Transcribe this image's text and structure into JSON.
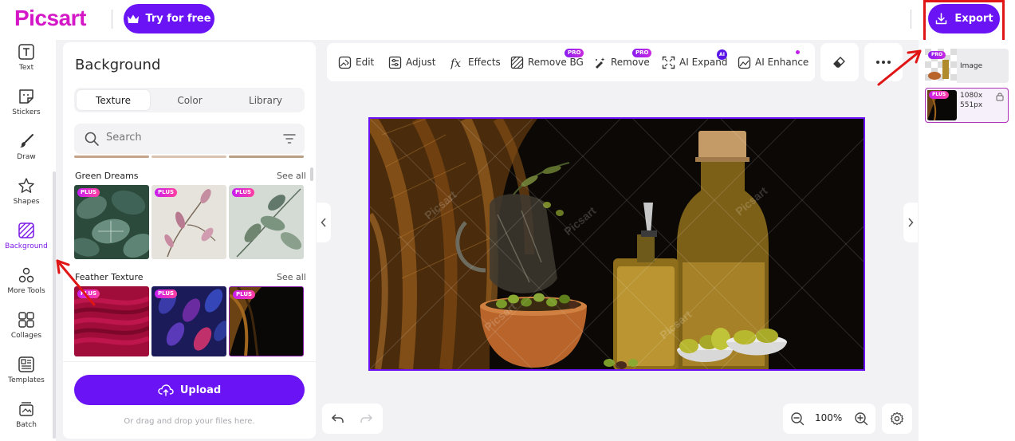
{
  "header": {
    "logo": "Picsart",
    "try_label": "Try for free",
    "export_label": "Export"
  },
  "rail": {
    "items": [
      {
        "label": "Text",
        "icon": "text-icon"
      },
      {
        "label": "Stickers",
        "icon": "sticker-icon"
      },
      {
        "label": "Draw",
        "icon": "brush-icon"
      },
      {
        "label": "Shapes",
        "icon": "star-icon"
      },
      {
        "label": "Background",
        "icon": "background-icon",
        "active": true
      },
      {
        "label": "More Tools",
        "icon": "more-tools-icon"
      },
      {
        "label": "Collages",
        "icon": "collage-icon"
      },
      {
        "label": "Templates",
        "icon": "templates-icon"
      },
      {
        "label": "Batch",
        "icon": "batch-icon"
      }
    ]
  },
  "panel": {
    "title": "Background",
    "tabs": [
      "Texture",
      "Color",
      "Library"
    ],
    "active_tab": "Texture",
    "search_placeholder": "Search",
    "sections": [
      {
        "title": "Green Dreams",
        "see_all": "See all",
        "badge": "PLUS"
      },
      {
        "title": "Feather Texture",
        "see_all": "See all",
        "badge": "PLUS"
      }
    ],
    "upload_label": "Upload",
    "drop_hint": "Or drag and drop your files here."
  },
  "toolbar": {
    "tools": [
      {
        "label": "Edit",
        "icon": "edit-image-icon"
      },
      {
        "label": "Adjust",
        "icon": "adjust-icon"
      },
      {
        "label": "Effects",
        "icon": "fx-icon"
      },
      {
        "label": "Remove BG",
        "icon": "remove-bg-icon",
        "badge": "PRO"
      },
      {
        "label": "Remove",
        "icon": "magic-eraser-icon",
        "badge": "PRO"
      },
      {
        "label": "AI Expand",
        "icon": "expand-icon",
        "badge": "AI"
      },
      {
        "label": "AI Enhance",
        "icon": "enhance-icon"
      }
    ]
  },
  "zoom": {
    "value": "100%"
  },
  "layers": {
    "image_label": "Image",
    "image_badge": "PRO",
    "bg_badge": "PLUS",
    "bg_size_line1": "1080x",
    "bg_size_line2": "551px"
  },
  "canvas": {
    "watermark": "Picsart"
  },
  "colors": {
    "accent": "#6a14f5",
    "logo": "#d418c8",
    "highlight": "#e01515"
  }
}
